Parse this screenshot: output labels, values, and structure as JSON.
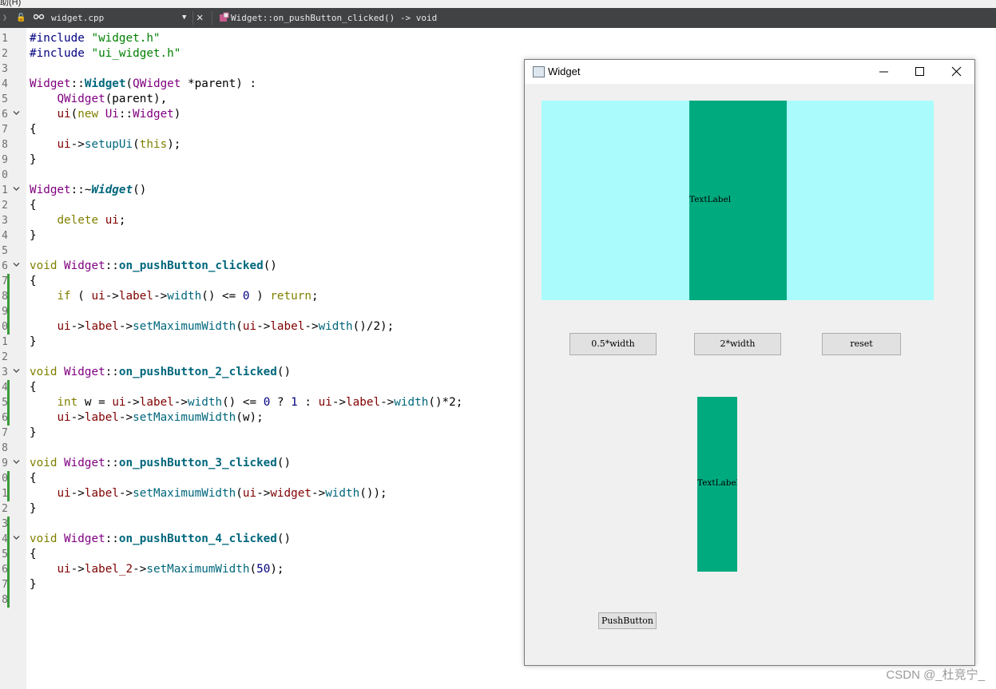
{
  "menu": {
    "fragment": "助(H)"
  },
  "tabbar": {
    "file": "widget.cpp",
    "symbol": "Widget::on_pushButton_clicked() -> void"
  },
  "gutter": {
    "line_numbers": [
      "1",
      "2",
      "3",
      "4",
      "5",
      "6",
      "7",
      "8",
      "9",
      "0",
      "1",
      "2",
      "3",
      "4",
      "5",
      "6",
      "7",
      "8",
      "9",
      "0",
      "1",
      "2",
      "3",
      "4",
      "5",
      "6",
      "7",
      "8",
      "9",
      "0",
      "1",
      "2",
      "3",
      "4",
      "5",
      "6",
      "7",
      "8"
    ]
  },
  "code": [
    [
      [
        "pp",
        "#include "
      ],
      [
        "str",
        "\"widget.h\""
      ]
    ],
    [
      [
        "pp",
        "#include "
      ],
      [
        "str",
        "\"ui_widget.h\""
      ]
    ],
    [],
    [
      [
        "cls",
        "Widget"
      ],
      [
        "",
        "::"
      ],
      [
        "fnb",
        "Widget"
      ],
      [
        "",
        "("
      ],
      [
        "cls",
        "QWidget"
      ],
      [
        "",
        " *parent) :"
      ]
    ],
    [
      [
        "",
        "    "
      ],
      [
        "cls",
        "QWidget"
      ],
      [
        "",
        "(parent),"
      ]
    ],
    [
      [
        "",
        "    "
      ],
      [
        "mem",
        "ui"
      ],
      [
        "",
        "("
      ],
      [
        "kw",
        "new"
      ],
      [
        "",
        " "
      ],
      [
        "cls",
        "Ui"
      ],
      [
        "",
        "::"
      ],
      [
        "cls",
        "Widget"
      ],
      [
        "",
        ")"
      ]
    ],
    [
      [
        "",
        "{"
      ]
    ],
    [
      [
        "",
        "    "
      ],
      [
        "mem",
        "ui"
      ],
      [
        "",
        "->"
      ],
      [
        "fn",
        "setupUi"
      ],
      [
        "",
        "("
      ],
      [
        "kw",
        "this"
      ],
      [
        "",
        ");"
      ]
    ],
    [
      [
        "",
        "}"
      ]
    ],
    [],
    [
      [
        "cls",
        "Widget"
      ],
      [
        "",
        "::~"
      ],
      [
        "fni",
        "Widget"
      ],
      [
        "",
        "()"
      ]
    ],
    [
      [
        "",
        "{"
      ]
    ],
    [
      [
        "",
        "    "
      ],
      [
        "kw",
        "delete"
      ],
      [
        "",
        " "
      ],
      [
        "mem",
        "ui"
      ],
      [
        "",
        ";"
      ]
    ],
    [
      [
        "",
        "}"
      ]
    ],
    [],
    [
      [
        "kw",
        "void"
      ],
      [
        "",
        " "
      ],
      [
        "cls",
        "Widget"
      ],
      [
        "",
        "::"
      ],
      [
        "fnb",
        "on_pushButton_clicked"
      ],
      [
        "",
        "()"
      ]
    ],
    [
      [
        "",
        "{"
      ]
    ],
    [
      [
        "",
        "    "
      ],
      [
        "kw",
        "if"
      ],
      [
        "",
        " ( "
      ],
      [
        "mem",
        "ui"
      ],
      [
        "",
        "->"
      ],
      [
        "mem",
        "label"
      ],
      [
        "",
        "->"
      ],
      [
        "fn",
        "width"
      ],
      [
        "",
        "() <= "
      ],
      [
        "num",
        "0"
      ],
      [
        "",
        " ) "
      ],
      [
        "kw",
        "return"
      ],
      [
        "",
        ";"
      ]
    ],
    [],
    [
      [
        "",
        "    "
      ],
      [
        "mem",
        "ui"
      ],
      [
        "",
        "->"
      ],
      [
        "mem",
        "label"
      ],
      [
        "",
        "->"
      ],
      [
        "fn",
        "setMaximumWidth"
      ],
      [
        "",
        "("
      ],
      [
        "mem",
        "ui"
      ],
      [
        "",
        "->"
      ],
      [
        "mem",
        "label"
      ],
      [
        "",
        "->"
      ],
      [
        "fn",
        "width"
      ],
      [
        "",
        "()/2);"
      ]
    ],
    [
      [
        "",
        "}"
      ]
    ],
    [],
    [
      [
        "kw",
        "void"
      ],
      [
        "",
        " "
      ],
      [
        "cls",
        "Widget"
      ],
      [
        "",
        "::"
      ],
      [
        "fnb",
        "on_pushButton_2_clicked"
      ],
      [
        "",
        "()"
      ]
    ],
    [
      [
        "",
        "{"
      ]
    ],
    [
      [
        "",
        "    "
      ],
      [
        "kw",
        "int"
      ],
      [
        "",
        " w = "
      ],
      [
        "mem",
        "ui"
      ],
      [
        "",
        "->"
      ],
      [
        "mem",
        "label"
      ],
      [
        "",
        "->"
      ],
      [
        "fn",
        "width"
      ],
      [
        "",
        "() <= "
      ],
      [
        "num",
        "0"
      ],
      [
        "",
        " ? "
      ],
      [
        "num",
        "1"
      ],
      [
        "",
        " : "
      ],
      [
        "mem",
        "ui"
      ],
      [
        "",
        "->"
      ],
      [
        "mem",
        "label"
      ],
      [
        "",
        "->"
      ],
      [
        "fn",
        "width"
      ],
      [
        "",
        "()*2;"
      ]
    ],
    [
      [
        "",
        "    "
      ],
      [
        "mem",
        "ui"
      ],
      [
        "",
        "->"
      ],
      [
        "mem",
        "label"
      ],
      [
        "",
        "->"
      ],
      [
        "fn",
        "setMaximumWidth"
      ],
      [
        "",
        "(w);"
      ]
    ],
    [
      [
        "",
        "}"
      ]
    ],
    [],
    [
      [
        "kw",
        "void"
      ],
      [
        "",
        " "
      ],
      [
        "cls",
        "Widget"
      ],
      [
        "",
        "::"
      ],
      [
        "fnb",
        "on_pushButton_3_clicked"
      ],
      [
        "",
        "()"
      ]
    ],
    [
      [
        "",
        "{"
      ]
    ],
    [
      [
        "",
        "    "
      ],
      [
        "mem",
        "ui"
      ],
      [
        "",
        "->"
      ],
      [
        "mem",
        "label"
      ],
      [
        "",
        "->"
      ],
      [
        "fn",
        "setMaximumWidth"
      ],
      [
        "",
        "("
      ],
      [
        "mem",
        "ui"
      ],
      [
        "",
        "->"
      ],
      [
        "mem",
        "widget"
      ],
      [
        "",
        "->"
      ],
      [
        "fn",
        "width"
      ],
      [
        "",
        "());"
      ]
    ],
    [
      [
        "",
        "}"
      ]
    ],
    [],
    [
      [
        "kw",
        "void"
      ],
      [
        "",
        " "
      ],
      [
        "cls",
        "Widget"
      ],
      [
        "",
        "::"
      ],
      [
        "fnb",
        "on_pushButton_4_clicked"
      ],
      [
        "",
        "()"
      ]
    ],
    [
      [
        "",
        "{"
      ]
    ],
    [
      [
        "",
        "    "
      ],
      [
        "mem",
        "ui"
      ],
      [
        "",
        "->"
      ],
      [
        "mem",
        "label_2"
      ],
      [
        "",
        "->"
      ],
      [
        "fn",
        "setMaximumWidth"
      ],
      [
        "",
        "("
      ],
      [
        "num",
        "50"
      ],
      [
        "",
        ");"
      ]
    ],
    [
      [
        "",
        "}"
      ]
    ],
    []
  ],
  "window": {
    "title": "Widget",
    "label1": "TextLabel",
    "label2": "TextLabel",
    "buttons": {
      "half": "0.5*width",
      "double": "2*width",
      "reset": "reset",
      "push": "PushButton"
    }
  },
  "colors": {
    "cyan_area": "#aafcfc",
    "label_green": "#00aa7f"
  },
  "watermark": "CSDN @_杜竞宁_"
}
